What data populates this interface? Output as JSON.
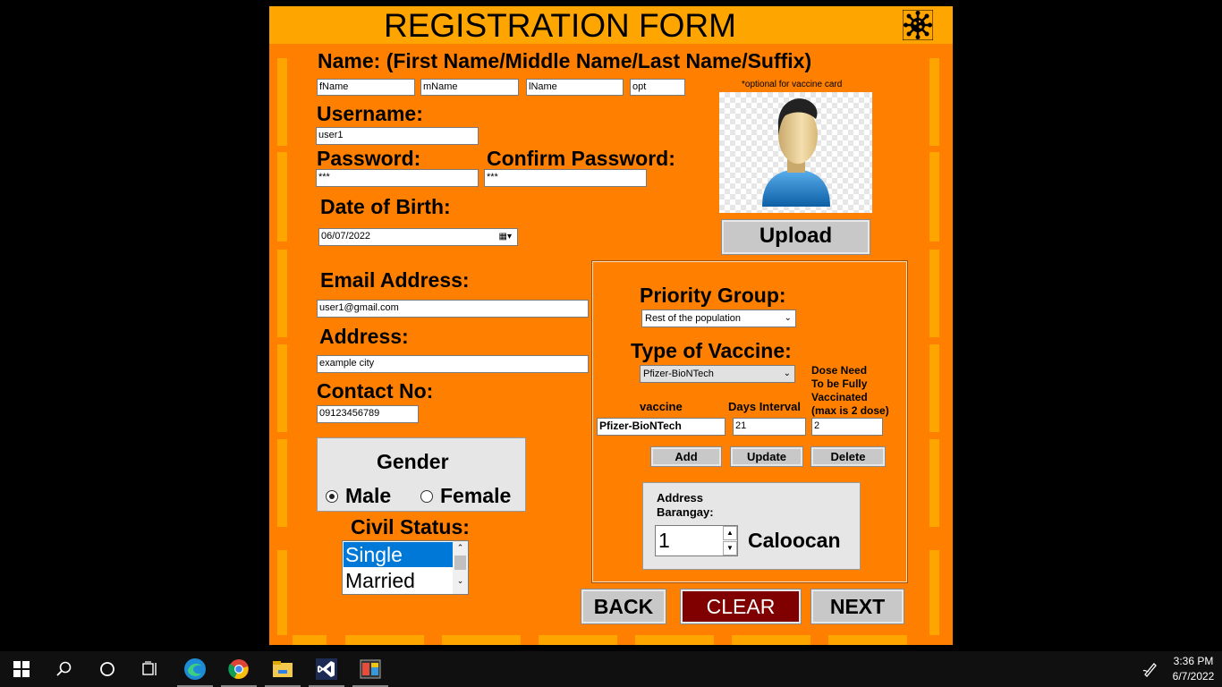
{
  "form": {
    "title": "REGISTRATION FORM",
    "name_label": "Name: (First Name/Middle Name/Last Name/Suffix)",
    "first_name": "fName",
    "middle_name": "mName",
    "last_name": "lName",
    "suffix": "opt",
    "optional_note": "*optional for vaccine card",
    "username_label": "Username:",
    "username": "user1",
    "password_label": "Password:",
    "password": "***",
    "confirm_password_label": "Confirm Password:",
    "confirm_password": "***",
    "upload_button": "Upload",
    "dob_label": "Date of Birth:",
    "dob": "06/07/2022",
    "email_label": "Email Address:",
    "email": "user1@gmail.com",
    "address_label": "Address:",
    "address": "example city",
    "contact_label": "Contact No:",
    "contact": "09123456789",
    "gender_label": "Gender",
    "gender_male": "Male",
    "gender_female": "Female",
    "gender_selected": "Male",
    "civil_status_label": "Civil Status:",
    "civil_status_options": [
      "Single",
      "Married"
    ],
    "civil_status_selected": "Single"
  },
  "vaccine_panel": {
    "priority_group_label": "Priority Group:",
    "priority_group": "Rest of the population",
    "vaccine_type_label": "Type of Vaccine:",
    "vaccine_type": "Pfizer-BioNTech",
    "dose_label_1": "Dose Need",
    "dose_label_2": "To be Fully",
    "dose_label_3": "Vaccinated",
    "dose_label_4": "(max is 2 dose)",
    "col_vaccine": "vaccine",
    "col_days": "Days Interval",
    "vaccine_value": "Pfizer-BioNTech",
    "days_value": "21",
    "dose_value": "2",
    "add_button": "Add",
    "update_button": "Update",
    "delete_button": "Delete",
    "barangay_label_1": "Address",
    "barangay_label_2": "Barangay:",
    "barangay_value": "1",
    "city": "Caloocan"
  },
  "nav": {
    "back": "BACK",
    "clear": "CLEAR",
    "next": "NEXT"
  },
  "colors": {
    "form_bg": "#ff8000",
    "accent": "#ffa500",
    "clear_button": "#800000"
  },
  "taskbar": {
    "time": "3:36 PM",
    "date": "6/7/2022",
    "icons": [
      "windows-start-icon",
      "search-icon",
      "cortana-icon",
      "task-view-icon",
      "edge-icon",
      "chrome-icon",
      "file-explorer-icon",
      "visual-studio-icon",
      "app-icon",
      "pen-icon"
    ]
  }
}
